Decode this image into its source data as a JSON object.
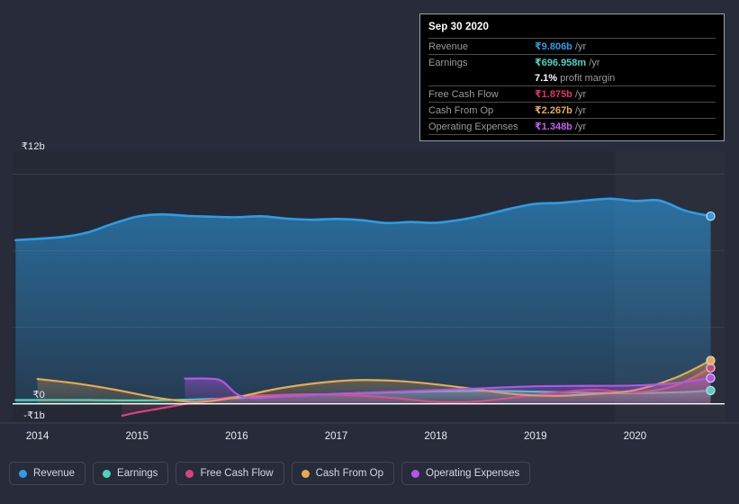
{
  "chart_data": {
    "type": "area",
    "title": "",
    "xlabel": "",
    "ylabel": "",
    "currency_symbol": "₹",
    "ylim": [
      -1,
      13.2
    ],
    "y_ticks": [
      {
        "label": "₹12b",
        "value": 12
      },
      {
        "label": "₹0",
        "value": 0
      },
      {
        "label": "-₹1b",
        "value": -1
      }
    ],
    "gridlines": [
      12,
      8,
      4,
      0
    ],
    "grid": true,
    "legend_position": "bottom",
    "x_ticks": [
      "2014",
      "2015",
      "2016",
      "2017",
      "2018",
      "2019",
      "2020"
    ],
    "x_range": [
      2013.75,
      2020.9
    ],
    "highlight_band": {
      "from": 2019.8,
      "to": 2020.9
    },
    "series": [
      {
        "name": "Revenue",
        "color": "#2d9ce4",
        "fill": true,
        "x": [
          2013.78,
          2014.25,
          2014.5,
          2014.75,
          2015.0,
          2015.25,
          2015.5,
          2015.75,
          2016.0,
          2016.25,
          2016.5,
          2016.75,
          2017.0,
          2017.25,
          2017.5,
          2017.75,
          2018.0,
          2018.25,
          2018.5,
          2018.75,
          2019.0,
          2019.25,
          2019.5,
          2019.75,
          2020.0,
          2020.25,
          2020.5,
          2020.76
        ],
        "values": [
          8.55,
          8.72,
          8.95,
          9.4,
          9.78,
          9.9,
          9.82,
          9.78,
          9.75,
          9.8,
          9.68,
          9.62,
          9.66,
          9.6,
          9.45,
          9.5,
          9.46,
          9.62,
          9.88,
          10.2,
          10.45,
          10.5,
          10.62,
          10.72,
          10.6,
          10.62,
          10.1,
          9.806
        ]
      },
      {
        "name": "Earnings",
        "color": "#4bd4c0",
        "fill": true,
        "x": [
          2013.78,
          2014.5,
          2015.0,
          2015.5,
          2016.0,
          2016.5,
          2017.0,
          2017.5,
          2018.0,
          2018.5,
          2019.0,
          2019.5,
          2020.0,
          2020.5,
          2020.76
        ],
        "values": [
          0.2,
          0.2,
          0.18,
          0.22,
          0.3,
          0.42,
          0.52,
          0.6,
          0.66,
          0.68,
          0.64,
          0.58,
          0.56,
          0.62,
          0.696958
        ]
      },
      {
        "name": "Free Cash Flow",
        "color": "#d6447f",
        "fill": true,
        "x": [
          2014.85,
          2015.0,
          2015.3,
          2015.6,
          2016.0,
          2016.4,
          2016.8,
          2017.2,
          2017.6,
          2018.0,
          2018.4,
          2018.8,
          2019.2,
          2019.6,
          2020.0,
          2020.4,
          2020.76
        ],
        "values": [
          -0.62,
          -0.45,
          -0.18,
          0.1,
          0.38,
          0.46,
          0.5,
          0.44,
          0.3,
          0.1,
          0.12,
          0.34,
          0.58,
          0.74,
          0.6,
          0.95,
          1.875
        ]
      },
      {
        "name": "Cash From Op",
        "color": "#e8aa4f",
        "fill": true,
        "x": [
          2014.0,
          2014.4,
          2014.8,
          2015.2,
          2015.6,
          2016.0,
          2016.4,
          2016.8,
          2017.2,
          2017.6,
          2018.0,
          2018.4,
          2018.8,
          2019.2,
          2019.6,
          2020.0,
          2020.4,
          2020.76
        ],
        "values": [
          1.3,
          1.06,
          0.72,
          0.32,
          0.1,
          0.35,
          0.78,
          1.08,
          1.24,
          1.2,
          1.02,
          0.76,
          0.5,
          0.42,
          0.52,
          0.72,
          1.35,
          2.267
        ]
      },
      {
        "name": "Operating Expenses",
        "color": "#b455e8",
        "fill": true,
        "x": [
          2015.48,
          2015.7,
          2015.85,
          2016.0,
          2016.15,
          2016.5,
          2017.0,
          2017.5,
          2018.0,
          2018.5,
          2019.0,
          2019.5,
          2020.0,
          2020.4,
          2020.76
        ],
        "values": [
          1.32,
          1.32,
          1.2,
          0.52,
          0.3,
          0.4,
          0.52,
          0.62,
          0.72,
          0.82,
          0.92,
          0.94,
          0.96,
          1.08,
          1.348
        ]
      }
    ]
  },
  "tooltip": {
    "title": "Sep 30 2020",
    "rows": [
      {
        "key": "Revenue",
        "value": "₹9.806b",
        "unit": "/yr",
        "color": "#2d9ce4"
      },
      {
        "key": "Earnings",
        "value": "₹696.958m",
        "unit": "/yr",
        "color": "#4bd4c0"
      },
      {
        "key": "",
        "value": "7.1%",
        "unit": "profit margin",
        "color": "#ffffff"
      },
      {
        "key": "Free Cash Flow",
        "value": "₹1.875b",
        "unit": "/yr",
        "color": "#e0336e"
      },
      {
        "key": "Cash From Op",
        "value": "₹2.267b",
        "unit": "/yr",
        "color": "#e8aa4f"
      },
      {
        "key": "Operating Expenses",
        "value": "₹1.348b",
        "unit": "/yr",
        "color": "#c45ff0"
      }
    ]
  },
  "legend": {
    "items": [
      {
        "label": "Revenue",
        "color": "#2d9ce4"
      },
      {
        "label": "Earnings",
        "color": "#4bd4c0"
      },
      {
        "label": "Free Cash Flow",
        "color": "#d6447f"
      },
      {
        "label": "Cash From Op",
        "color": "#e8aa4f"
      },
      {
        "label": "Operating Expenses",
        "color": "#b455e8"
      }
    ]
  },
  "theme": {
    "page_background": "#282c3a",
    "plot_background": "#252936",
    "zero_line": "#ffffff",
    "grid_color": "#3d4251",
    "axis_text": "#e8eaf0"
  }
}
